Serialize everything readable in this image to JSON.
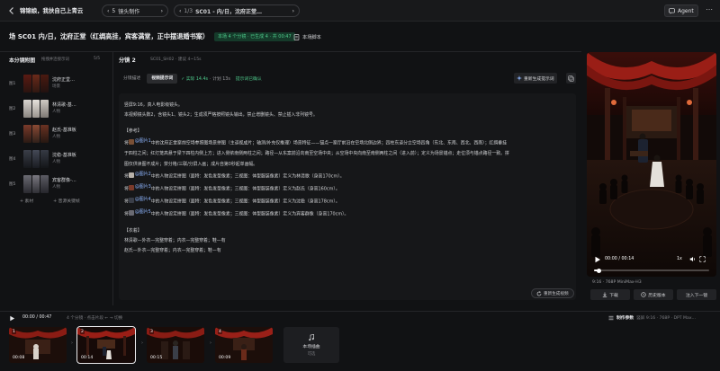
{
  "colors": {
    "accent_green": "#4ec98a",
    "link_blue": "#8fb6ff",
    "bg": "#111214",
    "panel": "#161719"
  },
  "header": {
    "project_title": "锦锦娘，我扶自己上青云",
    "step_index": "5",
    "step_label": "镜头制作",
    "scene_index": "1/3",
    "scene_label": "SC01 - 内/日，沈府正堂…",
    "agent_label": "Agent",
    "more_icon": "more-icon"
  },
  "scene": {
    "title": "场 SC01 内/日，沈府正堂（红绸高挂，宾客满堂，正中摆退婚书案）",
    "stat": "本场 4 个分镜 · 已生成 4 · 共 00:47",
    "script_button": "本场脚本"
  },
  "left": {
    "title": "本分镜附图",
    "subtitle": "拖拽并连接示词",
    "count": "5/5",
    "characters": [
      {
        "tag": "图1",
        "name": "沈府正堂…",
        "role": "场景"
      },
      {
        "tag": "图2",
        "name": "林清歌-基…",
        "role": "人物"
      },
      {
        "tag": "图3",
        "name": "赵氏-基准板",
        "role": "人物"
      },
      {
        "tag": "图4",
        "name": "沈稳-基准板",
        "role": "人物"
      },
      {
        "tag": "图5",
        "name": "宾客群像-…",
        "role": "人物"
      }
    ],
    "add_label": "+ 素材",
    "add_from_library": "+ 音源关键帧"
  },
  "shot": {
    "label": "分镜 2",
    "meta": "SC01_SH02 · 建议 4~15s",
    "tab_storyboard": "分镜描述",
    "tab_video_prompt": "视频提示词",
    "check_ok": "✓ 实际 14.4s",
    "check_meta": "· 计划 13s",
    "check_tip": "提示词已确认",
    "regen_label": "重新生成提示词",
    "regen_video_label": "重新生成视频"
  },
  "prompt": {
    "line1": "竖屏9:16，真人电影级镜头。",
    "line2": "本视频镜头数2，含镜头1、镜头2；生成须严格按照镜头输出，禁止增删镜头、禁止插入非列镜号。",
    "ref_heading": "【参考】",
    "ref_scene_pre": "将",
    "ref_scene_chip": "@图片1",
    "ref_scene_text": "中的沈府正堂案前空场参照图场景拼图（主道视成片；轴测/补充仅推理）场景特征——锚点一案厅前沿在空场北侧边界；四柱东道分立空场四角（东北、东南、西北、西南）；红绸垂挂",
    "ref_scene_cont": "于四柱之间；红灯笼高悬于梁下四柱内侧上方；进入侧依南侧两柱之间；路径—从东案前沿向南至空场中央；从空场中央向南至南侧两柱之间（进入前）；定义为场景锚点；走位须与锚点路径一致。拼",
    "ref_scene_cont2": "图仅供读图不成片；禁分格/三联/分屏入画；成片自第0秒起单画幅。",
    "refs": [
      {
        "pre": "将",
        "chip": "@图片2",
        "text": "中的人物设定拼图（面特：发色发型像素；三视图：体型服装像素）定义为林清歌（身高170cm）。"
      },
      {
        "pre": "将",
        "chip": "@图片3",
        "text": "中的人物设定拼图（面特：发色发型像素；三视图：体型服装像素）定义为赵氏（身高160cm）。"
      },
      {
        "pre": "将",
        "chip": "@图片4",
        "text": "中的人物设定拼图（面特：发色发型像素；三视图：体型服装像素）定义为沈稳（身高178cm）。"
      },
      {
        "pre": "将",
        "chip": "@图片5",
        "text": "中的人物设定拼图（面特：发色发型像素；三视图：体型服装像素）定义为宾客群像（身高170cm）。"
      }
    ],
    "costume_heading": "【衣着】",
    "costume1": "林清歌—外衣—完整穿着；内衣—完整穿着；鞋—有",
    "costume2": "赵氏—外衣—完整穿着；内衣—完整穿着；鞋—有"
  },
  "preview": {
    "time": "00:00 / 00:14",
    "speed": "1x",
    "progress": 0.04,
    "model_line": "9:16 · 768P MiniMax-H3",
    "download": "下载",
    "history": "历史版本",
    "replace": "注入下一镜"
  },
  "timeline": {
    "time": "00:00 / 00:47",
    "hint": "4 个分镜 · 点击片段 ← → 切换",
    "params_label": "制作参数",
    "params_value": "竖屏 9:16 · 768P · DPT Max…",
    "shots": [
      {
        "num": "1",
        "dur": "00:08"
      },
      {
        "num": "2",
        "dur": "00:14"
      },
      {
        "num": "3",
        "dur": "00:15"
      },
      {
        "num": "4",
        "dur": "00:09"
      }
    ],
    "add_scene": "本场插曲",
    "add_scene_sub": "可选"
  }
}
